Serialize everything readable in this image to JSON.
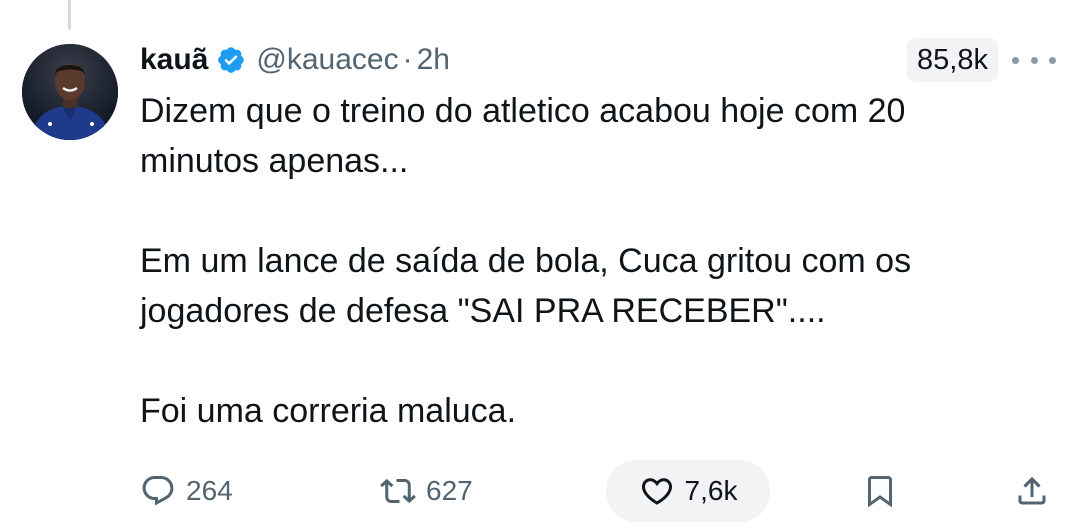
{
  "tweet": {
    "author": {
      "display_name": "kauã",
      "handle": "@kauacec",
      "separator": "·",
      "time": "2h",
      "verified": true
    },
    "views": "85,8k",
    "text": {
      "line1": "Dizem que o treino do atletico acabou hoje com 20",
      "line2": "minutos apenas...",
      "line3": "Em um lance de saída de bola, Cuca gritou com os",
      "line4": "jogadores de defesa \"SAI PRA RECEBER\"....",
      "line5": "Foi uma correria maluca."
    },
    "actions": {
      "replies": "264",
      "retweets": "627",
      "likes": "7,6k"
    }
  },
  "icons": {
    "verified": "verified-badge-icon",
    "more": "more-options-icon",
    "reply": "reply-icon",
    "retweet": "retweet-icon",
    "like": "heart-icon",
    "bookmark": "bookmark-icon",
    "share": "share-icon"
  },
  "colors": {
    "verified_blue": "#1d9bf0",
    "text": "#0f1419",
    "secondary": "#536471",
    "pill_bg": "#f1f3f4"
  }
}
